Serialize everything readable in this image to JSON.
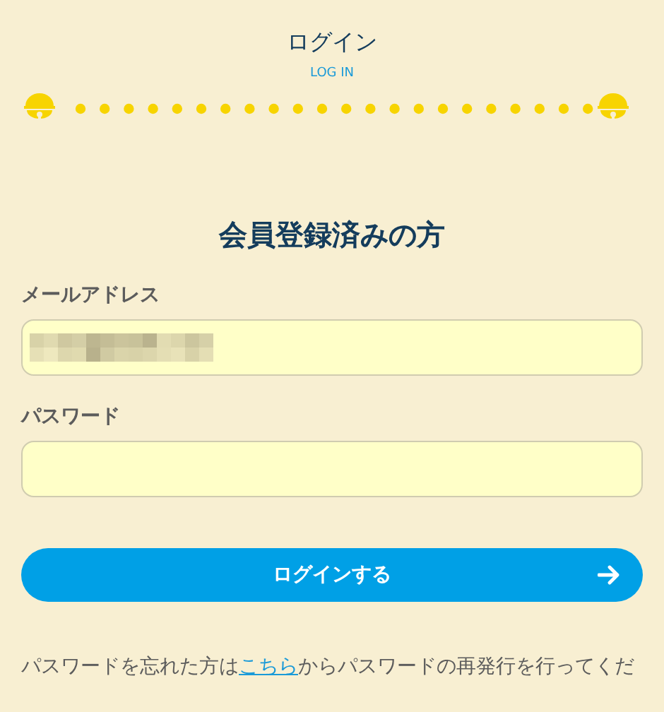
{
  "header": {
    "title": "ログイン",
    "subtitle": "LOG IN"
  },
  "section_title": "会員登録済みの方",
  "fields": [
    {
      "label": "メールアドレス",
      "redacted": true
    },
    {
      "label": "パスワード",
      "redacted": false
    }
  ],
  "login_button": {
    "label": "ログインする"
  },
  "forgot_note": {
    "before": "パスワードを忘れた方は",
    "link": "こちら",
    "after": "からパスワードの再発行を行ってくだ"
  }
}
